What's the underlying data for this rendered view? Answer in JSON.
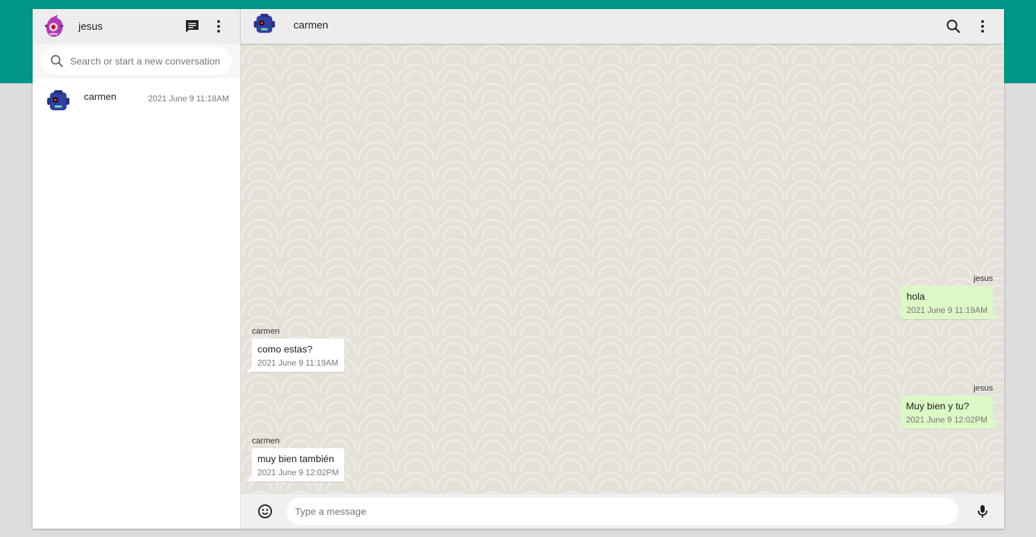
{
  "colors": {
    "header_band": "#009688",
    "outgoing_bubble": "#dcf8c6",
    "incoming_bubble": "#ffffff",
    "chat_background": "#e4e1d9"
  },
  "sidebar": {
    "user": {
      "name": "jesus",
      "avatar_icon": "purple-monster-avatar"
    },
    "new_chat_icon": "chat-icon",
    "menu_icon": "more-vert-icon",
    "search": {
      "placeholder": "Search or start a new conversation",
      "value": ""
    },
    "conversations": [
      {
        "name": "carmen",
        "time": "2021 June 9 11:18AM",
        "avatar_icon": "blue-robot-avatar"
      }
    ]
  },
  "chat": {
    "contact": {
      "name": "carmen",
      "avatar_icon": "blue-robot-avatar"
    },
    "search_icon": "search-icon",
    "menu_icon": "more-vert-icon",
    "messages": [
      {
        "direction": "out",
        "sender": "jesus",
        "text": "hola",
        "time": "2021 June 9 11:19AM"
      },
      {
        "direction": "in",
        "sender": "carmen",
        "text": "como estas?",
        "time": "2021 June 9 11:19AM"
      },
      {
        "direction": "out",
        "sender": "jesus",
        "text": "Muy bien y tu?",
        "time": "2021 June 9 12:02PM"
      },
      {
        "direction": "in",
        "sender": "carmen",
        "text": "muy bien también",
        "time": "2021 June 9 12:02PM"
      }
    ]
  },
  "composer": {
    "placeholder": "Type a message",
    "value": "",
    "emoji_icon": "emoji-icon",
    "mic_icon": "mic-icon"
  }
}
